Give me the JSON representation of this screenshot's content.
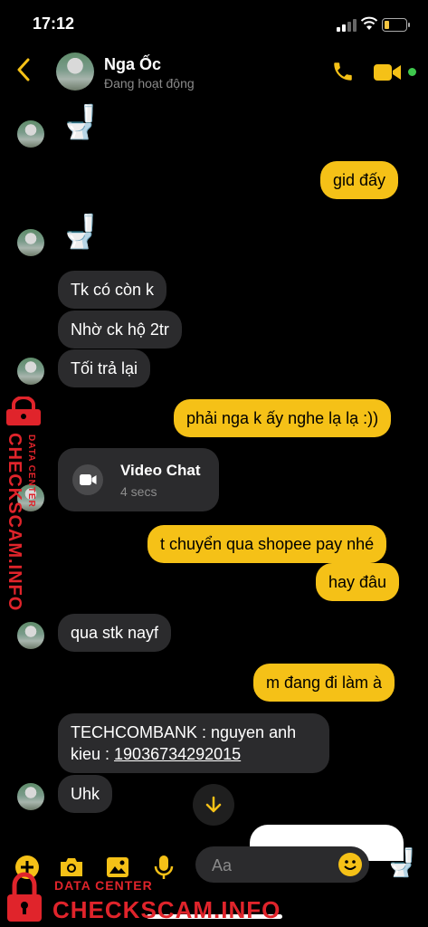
{
  "status_bar": {
    "time": "17:12"
  },
  "header": {
    "name": "Nga Ốc",
    "status": "Đang hoạt động",
    "back_icon": "chevron-left-icon",
    "call_icon": "phone-icon",
    "video_icon": "video-camera-icon",
    "accent": "#f5c117"
  },
  "messages": [
    {
      "side": "in",
      "type": "emoji",
      "text": "🚽"
    },
    {
      "side": "out",
      "type": "text",
      "text": "gid đấy"
    },
    {
      "side": "in",
      "type": "emoji",
      "text": "🚽"
    },
    {
      "side": "in",
      "type": "text",
      "text": "Tk có còn k"
    },
    {
      "side": "in",
      "type": "text",
      "text": "Nhờ ck hộ 2tr"
    },
    {
      "side": "in",
      "type": "text",
      "text": "Tối trả lại"
    },
    {
      "side": "out",
      "type": "text",
      "text": "phải nga k ấy nghe lạ lạ :))"
    },
    {
      "side": "in",
      "type": "video_chat",
      "title": "Video Chat",
      "subtitle": "4 secs"
    },
    {
      "side": "out",
      "type": "text",
      "text": "t chuyển qua shopee pay nhé"
    },
    {
      "side": "out",
      "type": "text",
      "text": "hay đâu"
    },
    {
      "side": "in",
      "type": "text",
      "text": "qua stk nayf"
    },
    {
      "side": "out",
      "type": "text",
      "text": "m đang đi làm à"
    },
    {
      "side": "in",
      "type": "text",
      "text": "TECHCOMBANK :  nguyen anh kieu : ",
      "link": "19036734292015"
    },
    {
      "side": "in",
      "type": "text",
      "text": "Uhk"
    }
  ],
  "composer": {
    "placeholder": "Aa",
    "icons": [
      "plus-icon",
      "camera-icon",
      "image-icon",
      "microphone-icon",
      "emoji-icon",
      "toilet-icon"
    ],
    "quick_reaction": "🚽"
  },
  "watermark": {
    "brand": "CHECKSCAM.INFO",
    "tagline": "DATA CENTER",
    "color": "#e0242b"
  }
}
